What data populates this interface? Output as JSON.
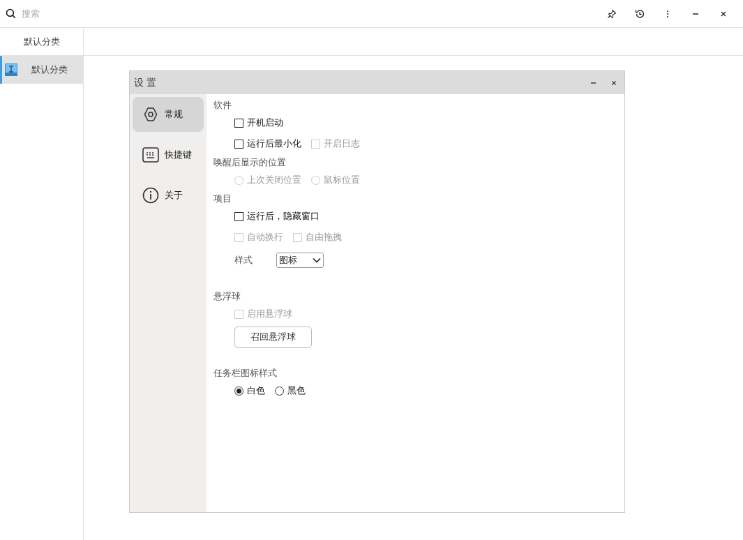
{
  "search": {
    "placeholder": "搜索"
  },
  "sidebar": {
    "header": "默认分类",
    "items": [
      {
        "label": "默认分类",
        "selected": true
      }
    ]
  },
  "dialog": {
    "title": "设 置",
    "nav": [
      {
        "label": "常规",
        "selected": true
      },
      {
        "label": "快捷键",
        "selected": false
      },
      {
        "label": "关于",
        "selected": false
      }
    ],
    "sections": [
      {
        "title": "软件",
        "rows": [
          [
            {
              "kind": "checkbox",
              "label": "开机启动",
              "checked": false,
              "disabled": false
            }
          ],
          [
            {
              "kind": "checkbox",
              "label": "运行后最小化",
              "checked": false,
              "disabled": false
            },
            {
              "kind": "checkbox",
              "label": "开启日志",
              "checked": false,
              "disabled": true
            }
          ]
        ]
      },
      {
        "title": "唤醒后显示的位置",
        "rows": [
          [
            {
              "kind": "radio",
              "label": "上次关闭位置",
              "selected": false,
              "disabled": true
            },
            {
              "kind": "radio",
              "label": "鼠标位置",
              "selected": false,
              "disabled": true
            }
          ]
        ]
      },
      {
        "title": "项目",
        "rows": [
          [
            {
              "kind": "checkbox",
              "label": "运行后，隐藏窗口",
              "checked": false,
              "disabled": false
            }
          ],
          [
            {
              "kind": "checkbox",
              "label": "自动换行",
              "checked": false,
              "disabled": true
            },
            {
              "kind": "checkbox",
              "label": "自由拖拽",
              "checked": false,
              "disabled": true
            }
          ],
          [
            {
              "kind": "select",
              "label": "样式",
              "value": "图标"
            }
          ]
        ]
      },
      {
        "title": "悬浮球",
        "rows": [
          [
            {
              "kind": "checkbox",
              "label": "启用悬浮球",
              "checked": false,
              "disabled": true
            }
          ],
          [
            {
              "kind": "button",
              "label": "召回悬浮球"
            }
          ]
        ]
      },
      {
        "title": "任务栏图标样式",
        "rows": [
          [
            {
              "kind": "radio",
              "label": "白色",
              "selected": true,
              "disabled": false
            },
            {
              "kind": "radio",
              "label": "黑色",
              "selected": false,
              "disabled": false
            }
          ]
        ]
      }
    ]
  }
}
